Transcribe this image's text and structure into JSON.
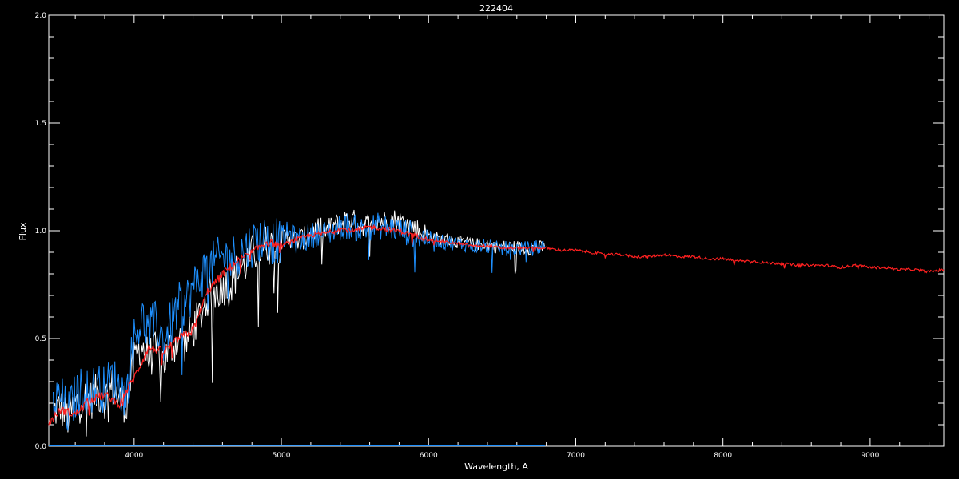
{
  "chart_data": {
    "type": "line",
    "title": "222404",
    "xlabel": "Wavelength, A",
    "ylabel": "Flux",
    "xlim": [
      3420,
      9500
    ],
    "ylim": [
      0,
      2.0
    ],
    "xticks": [
      4000,
      5000,
      6000,
      7000,
      8000,
      9000
    ],
    "xtick_labels": [
      "4000",
      "5000",
      "6000",
      "7000",
      "8000",
      "9000"
    ],
    "yticks": [
      0.0,
      0.5,
      1.0,
      1.5,
      2.0
    ],
    "ytick_labels": [
      "0.0",
      "0.5",
      "1.0",
      "1.5",
      "2.0"
    ],
    "background": "#000000",
    "axis_color": "#ffffff",
    "grid": false,
    "series": [
      {
        "color": "#ffffff",
        "x": [
          3450,
          3500,
          3550,
          3600,
          3650,
          3700,
          3750,
          3800,
          3850,
          3900,
          3950,
          4000,
          4050,
          4100,
          4150,
          4200,
          4250,
          4300,
          4350,
          4400,
          4450,
          4500,
          4550,
          4600,
          4650,
          4700,
          4750,
          4800,
          4850,
          4900,
          4950,
          5000,
          5050,
          5100,
          5150,
          5200,
          5250,
          5300,
          5350,
          5400,
          5450,
          5500,
          5550,
          5600,
          5650,
          5700,
          5750,
          5800,
          5850,
          5900,
          5950,
          6000,
          6050,
          6100,
          6150,
          6200,
          6250,
          6300,
          6350,
          6400,
          6450,
          6500,
          6550,
          6600,
          6650,
          6700,
          6750,
          6790
        ],
        "y": [
          0.17,
          0.19,
          0.14,
          0.2,
          0.24,
          0.22,
          0.26,
          0.23,
          0.28,
          0.22,
          0.21,
          0.4,
          0.48,
          0.42,
          0.45,
          0.4,
          0.47,
          0.5,
          0.49,
          0.55,
          0.62,
          0.7,
          0.72,
          0.76,
          0.75,
          0.82,
          0.85,
          0.9,
          0.92,
          0.95,
          0.93,
          0.96,
          0.98,
          0.96,
          0.97,
          0.99,
          1.02,
          1.0,
          1.03,
          1.04,
          1.06,
          1.05,
          1.03,
          1.04,
          1.06,
          1.05,
          1.06,
          1.05,
          1.04,
          1.02,
          1.0,
          0.98,
          0.97,
          0.96,
          0.96,
          0.95,
          0.95,
          0.94,
          0.94,
          0.94,
          0.93,
          0.93,
          0.93,
          0.93,
          0.92,
          0.92,
          0.93,
          0.92
        ]
      },
      {
        "color": "#1e90ff",
        "x": [
          3450,
          3500,
          3550,
          3600,
          3650,
          3700,
          3750,
          3800,
          3850,
          3900,
          3950,
          4000,
          4050,
          4100,
          4150,
          4200,
          4250,
          4300,
          4350,
          4400,
          4450,
          4500,
          4550,
          4600,
          4650,
          4700,
          4750,
          4800,
          4850,
          4900,
          4950,
          5000,
          5050,
          5100,
          5150,
          5200,
          5250,
          5300,
          5350,
          5400,
          5450,
          5500,
          5550,
          5600,
          5650,
          5700,
          5750,
          5800,
          5850,
          5900,
          5950,
          6000,
          6050,
          6100,
          6150,
          6200,
          6250,
          6300,
          6350,
          6400,
          6450,
          6500,
          6550,
          6600,
          6650,
          6700,
          6750,
          6790
        ],
        "y": [
          0.2,
          0.24,
          0.16,
          0.24,
          0.28,
          0.26,
          0.3,
          0.27,
          0.33,
          0.28,
          0.25,
          0.52,
          0.6,
          0.55,
          0.58,
          0.5,
          0.58,
          0.66,
          0.68,
          0.74,
          0.8,
          0.84,
          0.86,
          0.89,
          0.88,
          0.9,
          0.92,
          0.95,
          0.97,
          0.98,
          0.96,
          0.97,
          0.99,
          0.96,
          0.97,
          0.98,
          1.0,
          0.99,
          1.01,
          1.02,
          1.03,
          1.02,
          1.01,
          1.02,
          1.03,
          1.02,
          1.02,
          1.01,
          1.0,
          0.99,
          0.98,
          0.97,
          0.96,
          0.95,
          0.95,
          0.94,
          0.94,
          0.93,
          0.93,
          0.93,
          0.92,
          0.92,
          0.92,
          0.92,
          0.92,
          0.92,
          0.93,
          0.93
        ]
      },
      {
        "color": "#ff2020",
        "x": [
          3420,
          3500,
          3600,
          3700,
          3800,
          3900,
          4000,
          4100,
          4200,
          4300,
          4400,
          4500,
          4600,
          4700,
          4800,
          4900,
          5000,
          5100,
          5200,
          5300,
          5400,
          5500,
          5600,
          5700,
          5800,
          5900,
          6000,
          6100,
          6200,
          6300,
          6400,
          6500,
          6600,
          6700,
          6800,
          6900,
          7000,
          7100,
          7200,
          7300,
          7400,
          7500,
          7600,
          7700,
          7800,
          7900,
          8000,
          8100,
          8200,
          8300,
          8400,
          8500,
          8600,
          8700,
          8800,
          8900,
          9000,
          9100,
          9200,
          9300,
          9400,
          9500
        ],
        "y": [
          0.11,
          0.17,
          0.15,
          0.22,
          0.24,
          0.2,
          0.32,
          0.46,
          0.44,
          0.5,
          0.54,
          0.72,
          0.8,
          0.86,
          0.9,
          0.95,
          0.93,
          0.96,
          0.98,
          0.99,
          1.01,
          1.0,
          1.02,
          1.01,
          1.0,
          0.98,
          0.96,
          0.95,
          0.94,
          0.93,
          0.93,
          0.92,
          0.92,
          0.92,
          0.92,
          0.91,
          0.91,
          0.9,
          0.89,
          0.89,
          0.88,
          0.88,
          0.89,
          0.88,
          0.88,
          0.87,
          0.87,
          0.86,
          0.86,
          0.85,
          0.85,
          0.84,
          0.84,
          0.84,
          0.83,
          0.84,
          0.83,
          0.83,
          0.82,
          0.82,
          0.81,
          0.82
        ]
      },
      {
        "color": "#1e90ff",
        "x": [
          3420,
          4500,
          5500,
          6790
        ],
        "y": [
          0.002,
          0.003,
          0.002,
          0.002
        ]
      }
    ]
  }
}
